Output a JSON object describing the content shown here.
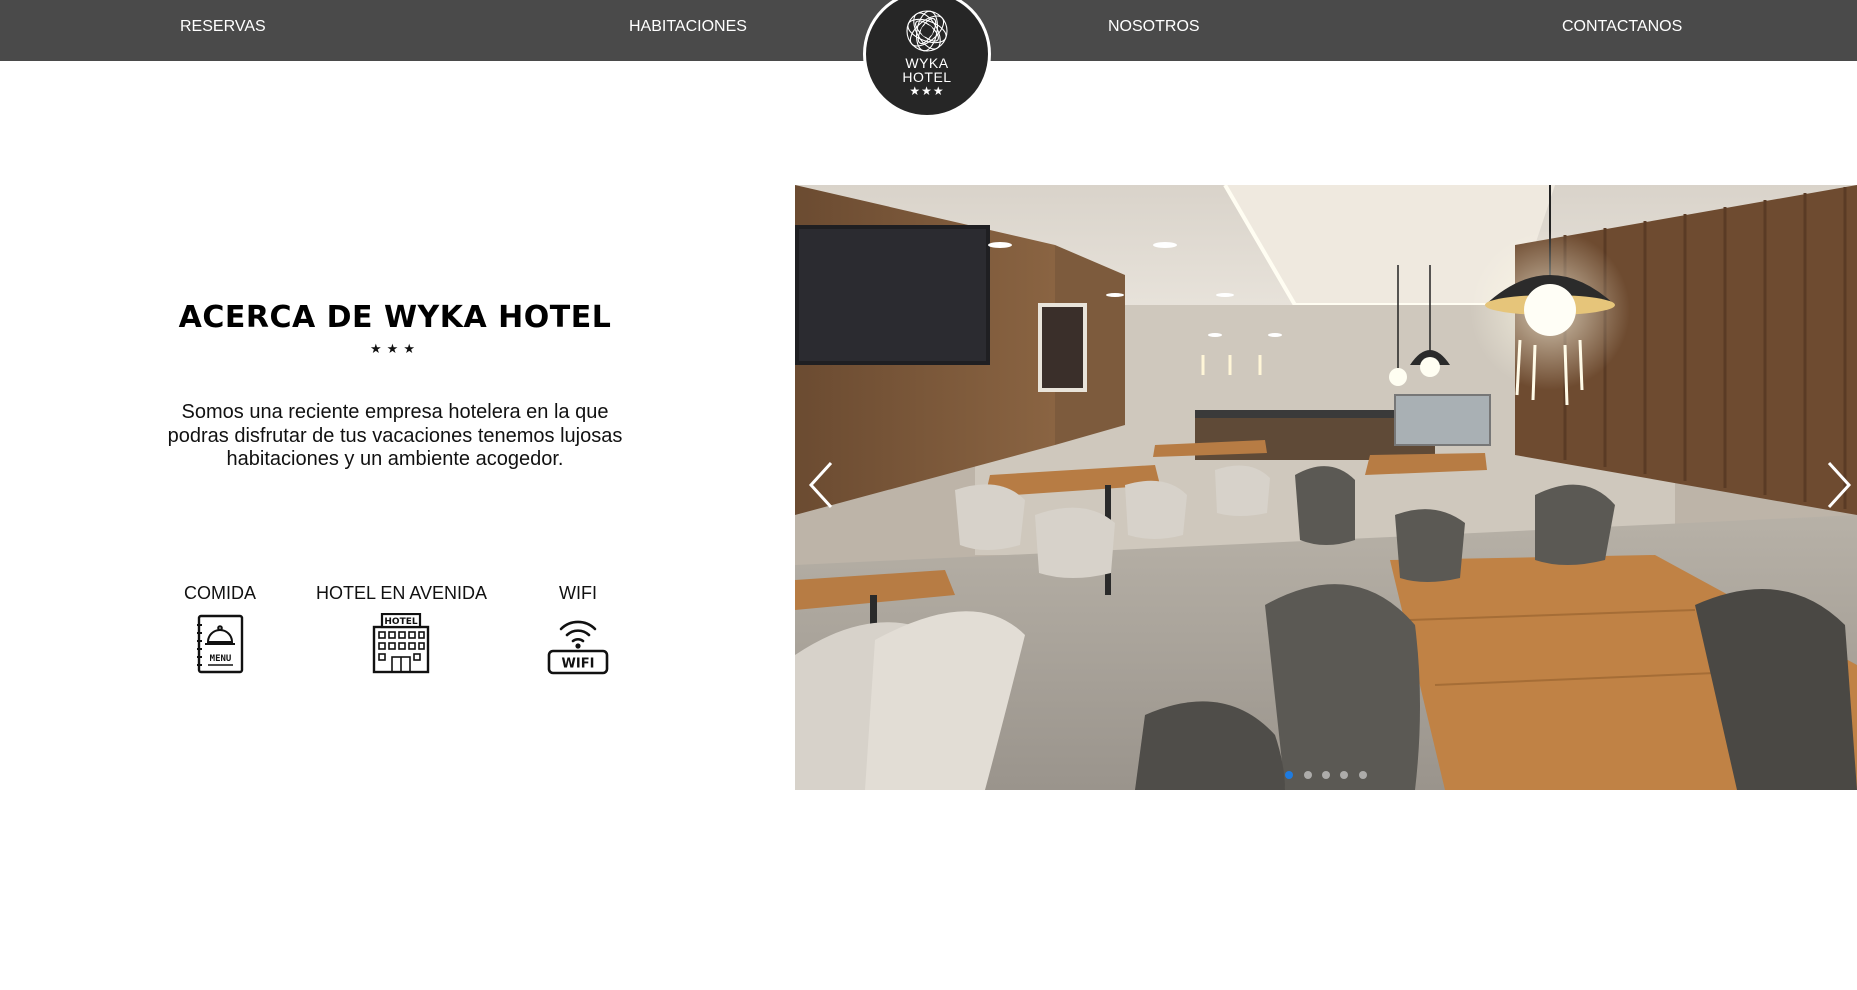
{
  "nav": {
    "links": [
      "RESERVAS",
      "HABITACIONES",
      "NOSOTROS",
      "CONTACTANOS"
    ],
    "logo": {
      "name": "WYKA",
      "sub": "HOTEL",
      "stars": "★★★"
    }
  },
  "about": {
    "title": "ACERCA DE WYKA HOTEL",
    "stars": "★★★",
    "text": "Somos una reciente empresa hotelera en la que podras disfrutar de tus vacaciones tenemos lujosas habitaciones y un ambiente acogedor."
  },
  "amenities": [
    {
      "label": "COMIDA",
      "icon": "menu-icon",
      "icon_text": "MENU"
    },
    {
      "label": "HOTEL EN AVENIDA",
      "icon": "hotel-building-icon",
      "icon_text": "HOTEL"
    },
    {
      "label": "WIFI",
      "icon": "wifi-icon",
      "icon_text": "WIFI"
    }
  ],
  "carousel": {
    "controls": {
      "prev": "chevron-left-icon",
      "next": "chevron-right-icon"
    },
    "active_indicator_color": "#1e7be0"
  }
}
